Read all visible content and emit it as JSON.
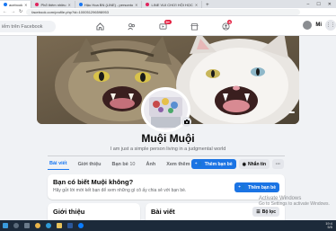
{
  "browser": {
    "tabs": [
      {
        "label": "acebook",
        "active": true
      },
      {
        "label": "Phổ thêm nhiều",
        "active": false
      },
      {
        "label": "Hậu Hoa BN (LINE) - personto",
        "active": false
      },
      {
        "label": "LINE VUI CHƠI HỘI HỌC",
        "active": false
      }
    ],
    "new_tab": "+",
    "url": "facebook.com/profile.php?id=100051296598953",
    "window_controls": [
      "–",
      "☐",
      "✕"
    ]
  },
  "facebook": {
    "search_placeholder": "iếm trên Facebook",
    "notification_badges": {
      "watch": "9+",
      "groups": "6"
    },
    "me_label": "Mi",
    "menu_icon": "grid-icon",
    "profile": {
      "name": "Muội Muội",
      "bio": "I am just a simple person living in a judgmental world",
      "tabs": [
        "Bài viết",
        "Giới thiệu",
        "Bạn bè",
        "Ảnh",
        "Xem thêm ▾"
      ],
      "tab_counts": {
        "friends": "10"
      },
      "add_friend": "Thêm bạn bè",
      "message": "Nhắn tin",
      "more": "···"
    },
    "pymk_card": {
      "title": "Bạn có biết Muội không?",
      "subtitle": "Hãy gửi lời mời kết bạn để xem những gì cô ấy chia sẻ với bạn bè.",
      "button": "Thêm bạn bè"
    },
    "intro_title": "Giới thiệu",
    "posts_title": "Bài viết",
    "filter_button": "Bộ lọc"
  },
  "windows": {
    "activate_title": "Activate Windows",
    "activate_sub": "Go to Settings to activate Windows.",
    "tray_time": "19:4",
    "tray_date": "5/5"
  },
  "colors": {
    "brand": "#1877f2",
    "badge": "#e41e3f"
  }
}
